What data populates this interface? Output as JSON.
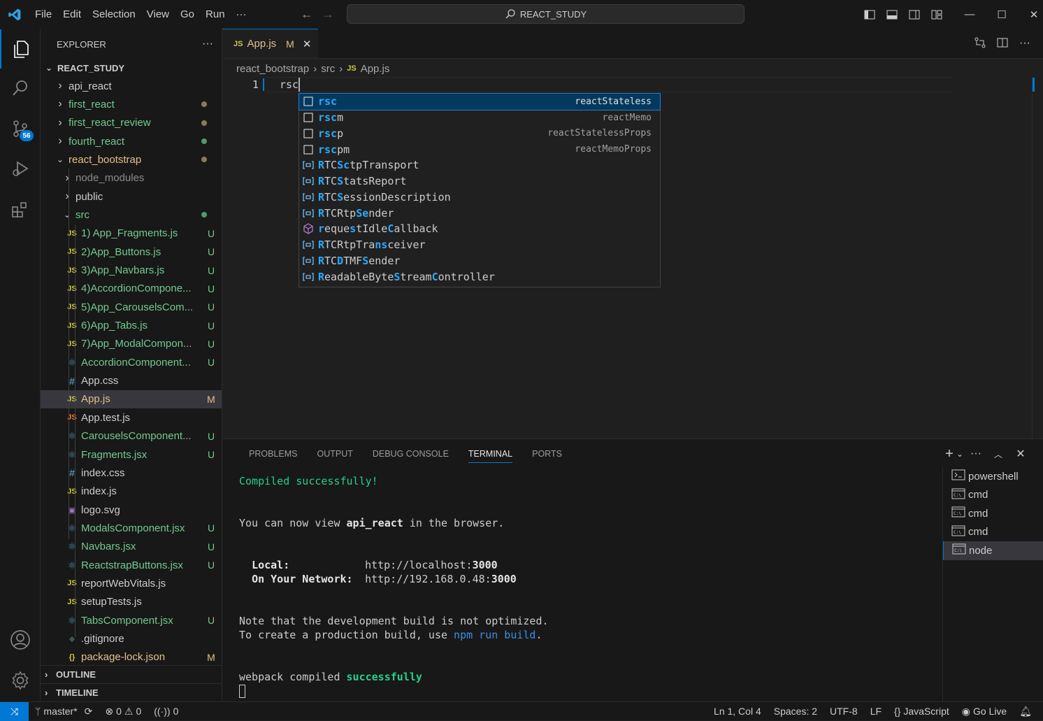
{
  "menu": [
    "File",
    "Edit",
    "Selection",
    "View",
    "Go",
    "Run",
    "···"
  ],
  "command_center": "REACT_STUDY",
  "activity": {
    "scm_badge": "56"
  },
  "explorer": {
    "title": "EXPLORER",
    "more": "···",
    "root": "REACT_STUDY",
    "items": [
      {
        "name": "api_react",
        "type": "folder",
        "collapsed": true,
        "status": "",
        "color": "#cccccc"
      },
      {
        "name": "first_react",
        "type": "folder",
        "collapsed": true,
        "status": "dot-gray",
        "color": "#73c991"
      },
      {
        "name": "first_react_review",
        "type": "folder",
        "collapsed": true,
        "status": "dot-gray",
        "color": "#73c991"
      },
      {
        "name": "fourth_react",
        "type": "folder",
        "collapsed": true,
        "status": "dot-green",
        "color": "#73c991"
      },
      {
        "name": "react_bootstrap",
        "type": "folder",
        "collapsed": false,
        "status": "dot-gray",
        "color": "#e2c08d"
      },
      {
        "name": "node_modules",
        "type": "folder",
        "collapsed": true,
        "status": "",
        "color": "#8c8c8c"
      },
      {
        "name": "public",
        "type": "folder",
        "collapsed": true,
        "status": "",
        "color": "#cccccc"
      },
      {
        "name": "src",
        "type": "folder",
        "collapsed": false,
        "status": "dot-green",
        "color": "#73c991"
      },
      {
        "name": "1) App_Fragments.js",
        "type": "js",
        "status": "U",
        "color": "#73c991"
      },
      {
        "name": "2)App_Buttons.js",
        "type": "js",
        "status": "U",
        "color": "#73c991"
      },
      {
        "name": "3)App_Navbars.js",
        "type": "js",
        "status": "U",
        "color": "#73c991"
      },
      {
        "name": "4)AccordionCompone...",
        "type": "js",
        "status": "U",
        "color": "#73c991"
      },
      {
        "name": "5)App_CarouselsCom...",
        "type": "js",
        "status": "U",
        "color": "#73c991"
      },
      {
        "name": "6)App_Tabs.js",
        "type": "js",
        "status": "U",
        "color": "#73c991"
      },
      {
        "name": "7)App_ModalCompon...",
        "type": "js",
        "status": "U",
        "color": "#73c991"
      },
      {
        "name": "AccordionComponent...",
        "type": "react",
        "status": "U",
        "color": "#73c991"
      },
      {
        "name": "App.css",
        "type": "css",
        "status": "",
        "color": "#cccccc"
      },
      {
        "name": "App.js",
        "type": "js",
        "status": "M",
        "color": "#e2c08d"
      },
      {
        "name": "App.test.js",
        "type": "jstest",
        "status": "",
        "color": "#cccccc"
      },
      {
        "name": "CarouselsComponent...",
        "type": "react",
        "status": "U",
        "color": "#73c991"
      },
      {
        "name": "Fragments.jsx",
        "type": "react",
        "status": "U",
        "color": "#73c991"
      },
      {
        "name": "index.css",
        "type": "css",
        "status": "",
        "color": "#cccccc"
      },
      {
        "name": "index.js",
        "type": "js",
        "status": "",
        "color": "#cccccc"
      },
      {
        "name": "logo.svg",
        "type": "svg",
        "status": "",
        "color": "#cccccc"
      },
      {
        "name": "ModalsComponent.jsx",
        "type": "react",
        "status": "U",
        "color": "#73c991"
      },
      {
        "name": "Navbars.jsx",
        "type": "react",
        "status": "U",
        "color": "#73c991"
      },
      {
        "name": "ReactstrapButtons.jsx",
        "type": "react",
        "status": "U",
        "color": "#73c991"
      },
      {
        "name": "reportWebVitals.js",
        "type": "js",
        "status": "",
        "color": "#cccccc"
      },
      {
        "name": "setupTests.js",
        "type": "js",
        "status": "",
        "color": "#cccccc"
      },
      {
        "name": "TabsComponent.jsx",
        "type": "react",
        "status": "U",
        "color": "#73c991"
      },
      {
        "name": ".gitignore",
        "type": "git",
        "status": "",
        "color": "#cccccc"
      },
      {
        "name": "package-lock.json",
        "type": "json",
        "status": "M",
        "color": "#e2c08d"
      }
    ],
    "sections": [
      "OUTLINE",
      "TIMELINE"
    ]
  },
  "editor": {
    "tab": {
      "icon": "JS",
      "name": "App.js",
      "status": "M"
    },
    "breadcrumbs": [
      "react_bootstrap",
      "src",
      "App.js"
    ],
    "line_number": "1",
    "code": "rsc"
  },
  "suggestions": [
    {
      "label": "rsc",
      "match": [
        [
          0,
          3
        ]
      ],
      "detail": "reactStateless",
      "kind": "snippet"
    },
    {
      "label": "rscm",
      "match": [
        [
          0,
          3
        ]
      ],
      "detail": "reactMemo",
      "kind": "snippet"
    },
    {
      "label": "rscp",
      "match": [
        [
          0,
          3
        ]
      ],
      "detail": "reactStatelessProps",
      "kind": "snippet"
    },
    {
      "label": "rscpm",
      "match": [
        [
          0,
          3
        ]
      ],
      "detail": "reactMemoProps",
      "kind": "snippet"
    },
    {
      "label": "RTCSctpTransport",
      "match": [
        [
          0,
          1
        ],
        [
          3,
          5
        ]
      ],
      "detail": "",
      "kind": "variable"
    },
    {
      "label": "RTCStatsReport",
      "match": [
        [
          0,
          1
        ],
        [
          3,
          4
        ]
      ],
      "detail": "",
      "kind": "variable"
    },
    {
      "label": "RTCSessionDescription",
      "match": [
        [
          0,
          1
        ],
        [
          3,
          4
        ]
      ],
      "detail": "",
      "kind": "variable"
    },
    {
      "label": "RTCRtpSender",
      "match": [
        [
          0,
          1
        ],
        [
          6,
          8
        ]
      ],
      "detail": "",
      "kind": "variable"
    },
    {
      "label": "requestIdleCallback",
      "match": [
        [
          0,
          1
        ],
        [
          5,
          6
        ],
        [
          11,
          12
        ]
      ],
      "detail": "",
      "kind": "method"
    },
    {
      "label": "RTCRtpTransceiver",
      "match": [
        [
          0,
          1
        ],
        [
          9,
          11
        ]
      ],
      "detail": "",
      "kind": "variable"
    },
    {
      "label": "RTCDTMFSender",
      "match": [
        [
          0,
          1
        ],
        [
          3,
          4
        ],
        [
          7,
          8
        ]
      ],
      "detail": "",
      "kind": "variable"
    },
    {
      "label": "ReadableByteStreamController",
      "match": [
        [
          0,
          1
        ],
        [
          12,
          13
        ],
        [
          18,
          19
        ]
      ],
      "detail": "",
      "kind": "variable"
    }
  ],
  "panel": {
    "tabs": [
      "PROBLEMS",
      "OUTPUT",
      "DEBUG CONSOLE",
      "TERMINAL",
      "PORTS"
    ],
    "active_tab": "TERMINAL",
    "terminal": {
      "compiled": "Compiled successfully!",
      "view_prefix": "You can now view ",
      "app_name": "api_react",
      "view_suffix": " in the browser.",
      "local_label": "Local:",
      "local_url_prefix": "http://localhost:",
      "local_port": "3000",
      "network_label": "On Your Network:",
      "network_url_prefix": "http://192.168.0.48:",
      "network_port": "3000",
      "note1": "Note that the development build is not optimized.",
      "note2_prefix": "To create a production build, use ",
      "note2_cmd": "npm run build",
      "note2_suffix": ".",
      "webpack_prefix": "webpack compiled ",
      "webpack_status": "successfully"
    },
    "terminals": [
      "powershell",
      "cmd",
      "cmd",
      "cmd",
      "node"
    ],
    "active_terminal": 4
  },
  "status": {
    "branch": "master*",
    "errors": "0",
    "warnings": "0",
    "ports": "0",
    "position": "Ln 1, Col 4",
    "spaces": "Spaces: 2",
    "encoding": "UTF-8",
    "eol": "LF",
    "language": "JavaScript",
    "golive": "Go Live"
  },
  "colors": {
    "accent": "#0078d4",
    "match": "#2aaaff",
    "green": "#23d18b",
    "js": "#cbcb41"
  }
}
